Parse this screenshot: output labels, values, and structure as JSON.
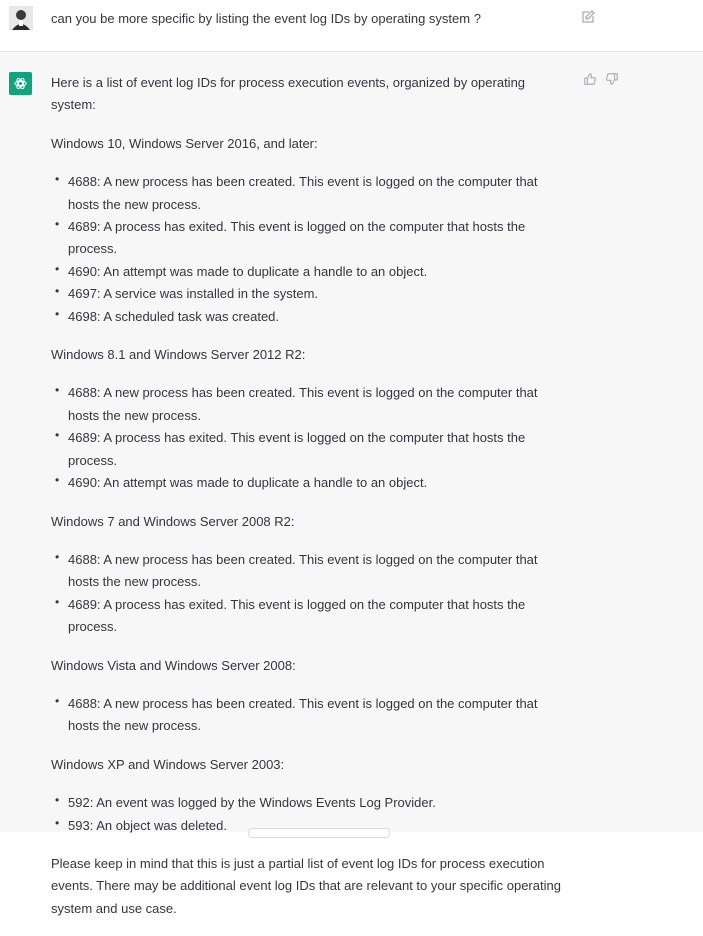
{
  "user_message": {
    "text": "can you be more specific by listing the event log IDs by operating system ?"
  },
  "assistant_message": {
    "intro": "Here is a list of event log IDs for process execution events, organized by operating system:",
    "sections": [
      {
        "heading": "Windows 10, Windows Server 2016, and later:",
        "items": [
          "4688: A new process has been created. This event is logged on the computer that hosts the new process.",
          "4689: A process has exited. This event is logged on the computer that hosts the process.",
          "4690: An attempt was made to duplicate a handle to an object.",
          "4697: A service was installed in the system.",
          "4698: A scheduled task was created."
        ]
      },
      {
        "heading": "Windows 8.1 and Windows Server 2012 R2:",
        "items": [
          "4688: A new process has been created. This event is logged on the computer that hosts the new process.",
          "4689: A process has exited. This event is logged on the computer that hosts the process.",
          "4690: An attempt was made to duplicate a handle to an object."
        ]
      },
      {
        "heading": "Windows 7 and Windows Server 2008 R2:",
        "items": [
          "4688: A new process has been created. This event is logged on the computer that hosts the new process.",
          "4689: A process has exited. This event is logged on the computer that hosts the process."
        ]
      },
      {
        "heading": "Windows Vista and Windows Server 2008:",
        "items": [
          "4688: A new process has been created. This event is logged on the computer that hosts the new process."
        ]
      },
      {
        "heading": "Windows XP and Windows Server 2003:",
        "items": [
          "592: An event was logged by the Windows Events Log Provider.",
          "593: An object was deleted."
        ]
      }
    ],
    "outro": "Please keep in mind that this is just a partial list of event log IDs for process execution events. There may be additional event log IDs that are relevant to your specific operating system and use case."
  },
  "icons": {
    "user_avatar": "user-avatar",
    "assistant_avatar": "openai-logo-icon",
    "edit": "edit-icon",
    "thumbs_up": "thumbs-up-icon",
    "thumbs_down": "thumbs-down-icon"
  },
  "colors": {
    "assistant_bg": "#f7f7f8",
    "assistant_avatar_bg": "#10a37f",
    "text": "#343541",
    "icon": "#acacbe"
  }
}
